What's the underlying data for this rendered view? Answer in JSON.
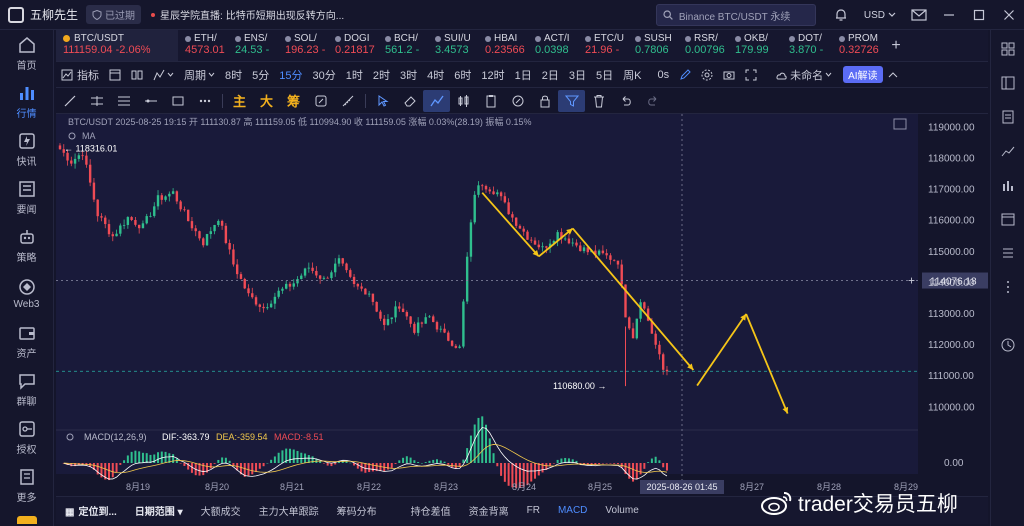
{
  "header": {
    "app_title": "五柳先生",
    "expired_label": "已过期",
    "news_source": "星辰学院直播:",
    "news_text": "比特币短期出现反转方向...",
    "search_placeholder": "Binance BTC/USDT 永续",
    "currency": "USD"
  },
  "sidebar": {
    "items": [
      {
        "label": "首页",
        "icon": "home-icon"
      },
      {
        "label": "行情",
        "icon": "chart-bars-icon",
        "active": true
      },
      {
        "label": "快讯",
        "icon": "flash-news-icon"
      },
      {
        "label": "要闻",
        "icon": "news-icon"
      },
      {
        "label": "策略",
        "icon": "robot-icon"
      },
      {
        "label": "Web3",
        "icon": "web3-icon"
      },
      {
        "label": "资产",
        "icon": "wallet-icon"
      },
      {
        "label": "群聊",
        "icon": "chat-icon"
      },
      {
        "label": "授权",
        "icon": "key-icon"
      },
      {
        "label": "更多",
        "icon": "more-icon"
      }
    ]
  },
  "tickers": {
    "main": {
      "symbol": "BTC/USDT",
      "price": "111159.04",
      "change": "-2.06%"
    },
    "items": [
      {
        "symbol": "ETH/",
        "price": "4573.01",
        "dir": "dn"
      },
      {
        "symbol": "ENS/",
        "price": "24.53 -",
        "dir": "up"
      },
      {
        "symbol": "SOL/",
        "price": "196.23 -",
        "dir": "dn"
      },
      {
        "symbol": "DOGI",
        "price": "0.21817",
        "dir": "dn"
      },
      {
        "symbol": "BCH/",
        "price": "561.2 -",
        "dir": "up"
      },
      {
        "symbol": "SUI/U",
        "price": "3.4573",
        "dir": "up"
      },
      {
        "symbol": "HBAI",
        "price": "0.23566",
        "dir": "dn"
      },
      {
        "symbol": "ACT/I",
        "price": "0.0398",
        "dir": "up"
      },
      {
        "symbol": "ETC/U",
        "price": "21.96 -",
        "dir": "dn"
      },
      {
        "symbol": "SUSH",
        "price": "0.7806",
        "dir": "up"
      },
      {
        "symbol": "RSR/",
        "price": "0.00796",
        "dir": "up"
      },
      {
        "symbol": "OKB/",
        "price": "179.99",
        "dir": "up"
      },
      {
        "symbol": "DOT/",
        "price": "3.870 -",
        "dir": "up"
      },
      {
        "symbol": "PROM",
        "price": "0.32726",
        "dir": "dn"
      }
    ]
  },
  "toolbar": {
    "indicators": "指标",
    "period": "周期",
    "intervals": [
      "8时",
      "5分",
      "15分",
      "30分",
      "1时",
      "2时",
      "3时",
      "4时",
      "6时",
      "12时",
      "1日",
      "2日",
      "3日",
      "5日",
      "周K"
    ],
    "selected_interval": "15分",
    "os": "0s",
    "layout_name": "未命名",
    "ai_label": "AI解读"
  },
  "drawing_tools": {
    "cn_labels": [
      "主",
      "大",
      "筹"
    ]
  },
  "chart_data": {
    "type": "candlestick",
    "legend_line": {
      "symbol": "BTC/USDT",
      "datetime": "2025-08-25 19:15",
      "open_label": "开",
      "open": "111130.87",
      "high_label": "高",
      "high": "111159.05",
      "low_label": "低",
      "low": "110994.90",
      "close_label": "收",
      "close": "111159.05",
      "change_label": "涨幅",
      "change": "0.03%(28.19)",
      "amp_label": "振幅",
      "amp": "0.15%"
    },
    "ma_label": "MA",
    "y_ticks": [
      "119000.00",
      "118000.00",
      "117000.00",
      "116000.00",
      "115000.00",
      "114000.00",
      "113000.00",
      "112000.00",
      "111000.00",
      "110000.00"
    ],
    "ylim": [
      109400,
      119300
    ],
    "crosshair_price": "114076.18",
    "annotations": {
      "high_marker": "118316.01",
      "low_marker": "110680.00"
    },
    "x_labels": [
      "8月19",
      "8月20",
      "8月21",
      "8月22",
      "8月23",
      "8月24",
      "8月25",
      "8月27",
      "8月28",
      "8月29"
    ],
    "crosshair_time": "2025-08-26 01:45",
    "price_path": [
      [
        0,
        118300
      ],
      [
        3,
        117900
      ],
      [
        6,
        118200
      ],
      [
        10,
        116200
      ],
      [
        14,
        115500
      ],
      [
        18,
        116100
      ],
      [
        22,
        115800
      ],
      [
        26,
        116700
      ],
      [
        30,
        116900
      ],
      [
        34,
        116000
      ],
      [
        38,
        115300
      ],
      [
        42,
        116100
      ],
      [
        46,
        114600
      ],
      [
        50,
        113600
      ],
      [
        54,
        113200
      ],
      [
        58,
        113700
      ],
      [
        62,
        114000
      ],
      [
        66,
        114500
      ],
      [
        70,
        114100
      ],
      [
        74,
        114700
      ],
      [
        78,
        113900
      ],
      [
        82,
        113700
      ],
      [
        86,
        112600
      ],
      [
        90,
        113300
      ],
      [
        94,
        112500
      ],
      [
        98,
        112900
      ],
      [
        102,
        112300
      ],
      [
        106,
        111900
      ],
      [
        108,
        114800
      ],
      [
        110,
        116900
      ],
      [
        112,
        117200
      ],
      [
        116,
        116900
      ],
      [
        120,
        116100
      ],
      [
        124,
        115500
      ],
      [
        128,
        115100
      ],
      [
        132,
        115600
      ],
      [
        136,
        115300
      ],
      [
        140,
        115000
      ],
      [
        144,
        114900
      ],
      [
        148,
        114700
      ],
      [
        150,
        113000
      ],
      [
        152,
        112300
      ],
      [
        154,
        113500
      ],
      [
        156,
        112800
      ],
      [
        158,
        112000
      ],
      [
        160,
        111200
      ],
      [
        161,
        111159
      ]
    ],
    "macd": {
      "label": "MACD(12,26,9)",
      "dif_label": "DIF:",
      "dif": "-363.79",
      "dea_label": "DEA:",
      "dea": "-359.54",
      "macd_label": "MACD:",
      "macd_value": "-8.51",
      "zero_tick": "0.00"
    },
    "drawn_forecast_paths": [
      [
        [
          116900,
          112
        ],
        [
          114850,
          127
        ],
        [
          115750,
          136
        ],
        [
          111200,
          168
        ]
      ],
      [
        [
          110700,
          169
        ],
        [
          113000,
          182
        ],
        [
          109800,
          193
        ]
      ]
    ]
  },
  "bottombar": {
    "items": [
      "定位到...",
      "日期范围",
      "大额成交",
      "主力大单跟踪",
      "筹码分布",
      "持仓差值",
      "资金背离",
      "FR",
      "MACD",
      "Volume"
    ],
    "selected": "MACD"
  },
  "watermark": {
    "text": "trader交易员五柳"
  },
  "colors": {
    "up": "#2fbf8e",
    "down": "#ef4b55",
    "accent": "#4e8dff",
    "forecast": "#f5c518",
    "bg": "#14152b"
  }
}
